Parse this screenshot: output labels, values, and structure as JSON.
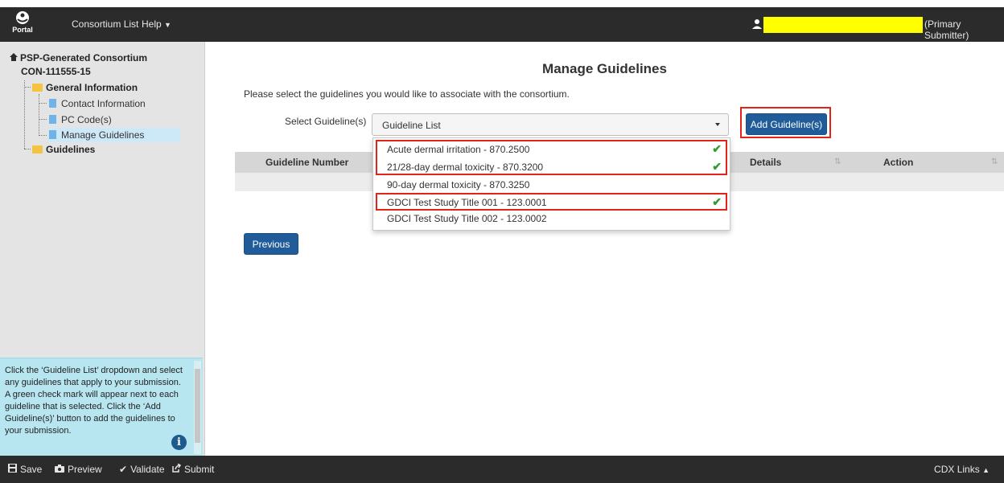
{
  "header": {
    "logo_text": "Portal",
    "nav": [
      "Consortium List",
      "Help"
    ],
    "user_role": "(Primary Submitter)"
  },
  "sidebar": {
    "root": "PSP-Generated Consortium",
    "consortium_id": "CON-111555-15",
    "general_info": "General Information",
    "items": [
      "Contact Information",
      "PC Code(s)",
      "Manage Guidelines"
    ],
    "guidelines": "Guidelines",
    "help_text": "Click the ‘Guideline List’ dropdown and select any guidelines that apply to your submission. A green check mark will appear next to each guideline that is selected. Click the ‘Add Guideline(s)’ button to add the guidelines to your submission."
  },
  "main": {
    "title": "Manage Guidelines",
    "instruction": "Please select the guidelines you would like to associate with the consortium.",
    "select_label": "Select Guideline(s)",
    "select_value": "Guideline List",
    "add_button": "Add Guideline(s)",
    "table_headers": [
      "Guideline Number",
      "Details",
      "Action"
    ],
    "previous_button": "Previous",
    "options": [
      {
        "label": "Acute dermal irritation - 870.2500",
        "selected": true
      },
      {
        "label": "21/28-day dermal toxicity - 870.3200",
        "selected": true
      },
      {
        "label": "90-day dermal toxicity - 870.3250",
        "selected": false
      },
      {
        "label": "GDCI Test Study Title 001 - 123.0001",
        "selected": true
      },
      {
        "label": "GDCI Test Study Title 002 - 123.0002",
        "selected": false
      }
    ]
  },
  "footer": {
    "actions": [
      "Save",
      "Preview",
      "Validate",
      "Submit"
    ],
    "cdx_links": "CDX Links"
  },
  "colors": {
    "accent": "#1f5c99",
    "highlight": "#e2231a",
    "check": "#2e9c2e",
    "redaction": "#ffff00"
  }
}
